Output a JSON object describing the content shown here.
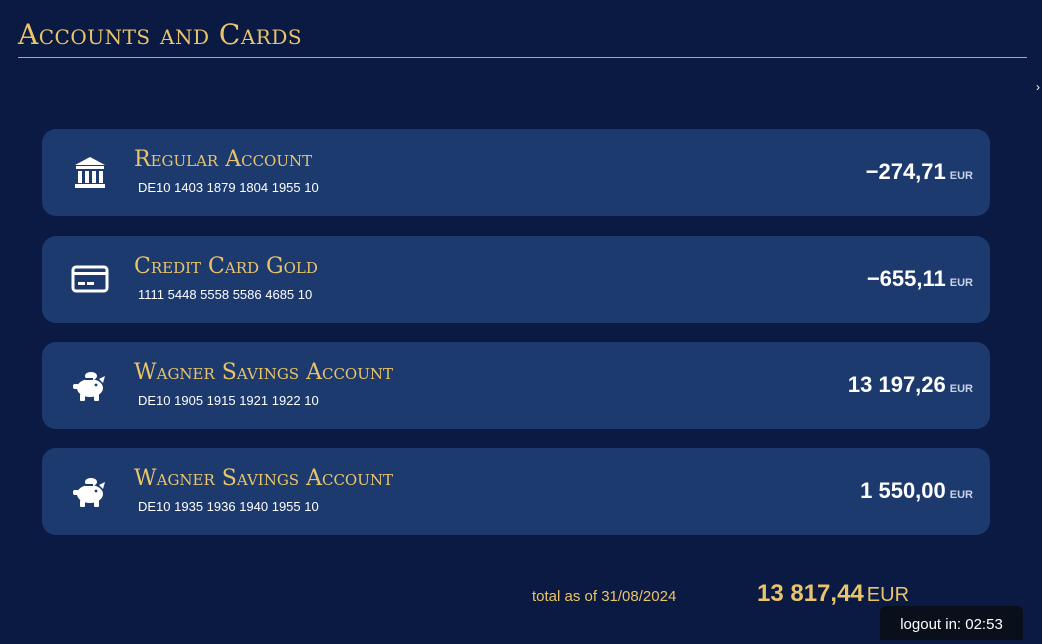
{
  "page": {
    "title": "Accounts and Cards"
  },
  "accounts": [
    {
      "icon": "bank-icon",
      "name": "Regular Account",
      "number": "DE10 1403 1879 1804 1955 10",
      "balance": "−274,71",
      "currency": "EUR"
    },
    {
      "icon": "credit-card-icon",
      "name": "Credit Card Gold",
      "number": "1111 5448 5558 5586 4685 10",
      "balance": "−655,11",
      "currency": "EUR"
    },
    {
      "icon": "piggy-bank-icon",
      "name": "Wagner Savings Account",
      "number": "DE10 1905 1915 1921 1922 10",
      "balance": "13 197,26",
      "currency": "EUR"
    },
    {
      "icon": "piggy-bank-icon",
      "name": "Wagner Savings Account",
      "number": "DE10 1935 1936 1940 1955 10",
      "balance": "1 550,00",
      "currency": "EUR"
    }
  ],
  "summary": {
    "label": "total as of 31/08/2024",
    "amount": "13 817,44",
    "currency": "EUR"
  },
  "session": {
    "logout_text": "logout in: 02:53"
  },
  "colors": {
    "background": "#0b1a42",
    "card": "#1d3a6e",
    "accent_gold": "#e9c46a",
    "text": "#ffffff"
  }
}
